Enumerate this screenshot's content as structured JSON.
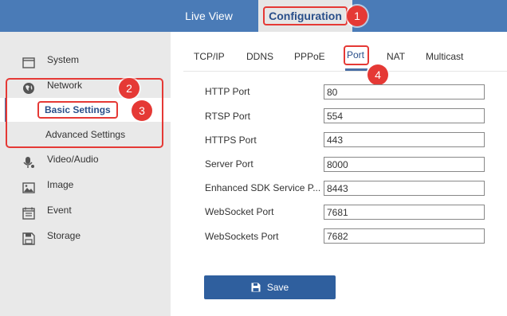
{
  "topbar": {
    "tabs": [
      {
        "label": "Live View"
      },
      {
        "label": "Configuration"
      }
    ]
  },
  "sidebar": {
    "items": [
      {
        "label": "System",
        "icon": "system-icon"
      },
      {
        "label": "Network",
        "icon": "network-globe-icon"
      },
      {
        "label": "Video/Audio",
        "icon": "microphone-camera-icon"
      },
      {
        "label": "Image",
        "icon": "image-icon"
      },
      {
        "label": "Event",
        "icon": "event-icon"
      },
      {
        "label": "Storage",
        "icon": "storage-icon"
      }
    ],
    "network_sub": [
      {
        "label": "Basic Settings",
        "active": true
      },
      {
        "label": "Advanced Settings",
        "active": false
      }
    ]
  },
  "tabs": [
    {
      "label": "TCP/IP"
    },
    {
      "label": "DDNS"
    },
    {
      "label": "PPPoE"
    },
    {
      "label": "Port",
      "active": true
    },
    {
      "label": "NAT"
    },
    {
      "label": "Multicast"
    }
  ],
  "ports": [
    {
      "label": "HTTP Port",
      "value": "80"
    },
    {
      "label": "RTSP Port",
      "value": "554"
    },
    {
      "label": "HTTPS Port",
      "value": "443"
    },
    {
      "label": "Server Port",
      "value": "8000"
    },
    {
      "label": "Enhanced SDK Service P...",
      "value": "8443"
    },
    {
      "label": "WebSocket Port",
      "value": "7681"
    },
    {
      "label": "WebSockets Port",
      "value": "7682"
    }
  ],
  "save_label": "Save",
  "annotations": [
    "1",
    "2",
    "3",
    "4"
  ],
  "colors": {
    "topbar": "#4a7bb7",
    "highlight": "#e53935",
    "primary_button": "#2f5f9e",
    "sidebar_bg": "#e9e9e9"
  }
}
